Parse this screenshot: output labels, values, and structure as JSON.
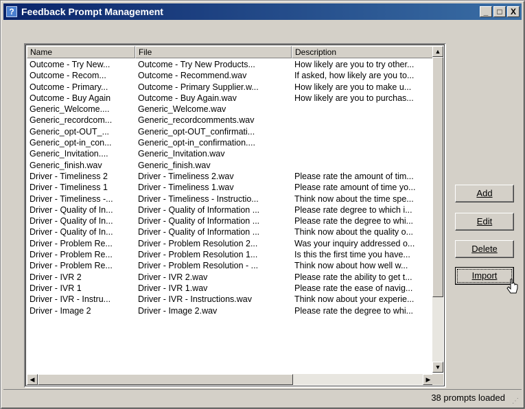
{
  "window": {
    "title": "Feedback Prompt Management",
    "icon": "question-icon",
    "title_buttons": {
      "minimize": "_",
      "maximize": "□",
      "close": "X"
    }
  },
  "list": {
    "columns": [
      "Name",
      "File",
      "Description"
    ],
    "rows": [
      [
        "Outcome - Try New...",
        "Outcome - Try New Products...",
        "How likely are you to try other..."
      ],
      [
        "Outcome - Recom...",
        "Outcome - Recommend.wav",
        "If asked, how likely are you to..."
      ],
      [
        "Outcome - Primary...",
        "Outcome - Primary Supplier.w...",
        "How likely are you to make u..."
      ],
      [
        "Outcome - Buy Again",
        "Outcome - Buy Again.wav",
        "How likely are you to purchas..."
      ],
      [
        "Generic_Welcome....",
        "Generic_Welcome.wav",
        ""
      ],
      [
        "Generic_recordcom...",
        "Generic_recordcomments.wav",
        ""
      ],
      [
        "Generic_opt-OUT_...",
        "Generic_opt-OUT_confirmati...",
        ""
      ],
      [
        "Generic_opt-in_con...",
        "Generic_opt-in_confirmation....",
        ""
      ],
      [
        "Generic_Invitation....",
        "Generic_Invitation.wav",
        ""
      ],
      [
        "Generic_finish.wav",
        "Generic_finish.wav",
        ""
      ],
      [
        "Driver - Timeliness 2",
        "Driver - Timeliness 2.wav",
        "Please rate the amount of tim..."
      ],
      [
        "Driver - Timeliness 1",
        "Driver - Timeliness 1.wav",
        "Please rate amount of time yo..."
      ],
      [
        "Driver - Timeliness -...",
        "Driver - Timeliness - Instructio...",
        "Think now about the time spe..."
      ],
      [
        "Driver - Quality of In...",
        "Driver - Quality of Information ...",
        "Please rate degree to which i..."
      ],
      [
        "Driver - Quality of In...",
        "Driver - Quality of Information ...",
        "Please rate the degree to whi..."
      ],
      [
        "Driver - Quality of In...",
        "Driver - Quality of Information ...",
        "Think now about the quality o..."
      ],
      [
        "Driver - Problem Re...",
        "Driver - Problem Resolution 2...",
        "Was your inquiry addressed o..."
      ],
      [
        "Driver - Problem Re...",
        "Driver - Problem Resolution 1...",
        "Is this the first time you have..."
      ],
      [
        "Driver - Problem Re...",
        "Driver - Problem Resolution - ...",
        "Think now about how well w..."
      ],
      [
        "Driver - IVR 2",
        "Driver - IVR 2.wav",
        "Please rate the ability to get t..."
      ],
      [
        "Driver - IVR 1",
        "Driver - IVR 1.wav",
        "Please rate the ease of navig..."
      ],
      [
        "Driver - IVR - Instru...",
        "Driver - IVR - Instructions.wav",
        "Think now about your experie..."
      ],
      [
        "Driver - Image 2",
        "Driver - Image 2.wav",
        "Please rate the degree to whi..."
      ]
    ]
  },
  "buttons": {
    "add": "Add",
    "edit": "Edit",
    "delete": "Delete",
    "import": "Import"
  },
  "status": {
    "text": "38 prompts loaded"
  }
}
